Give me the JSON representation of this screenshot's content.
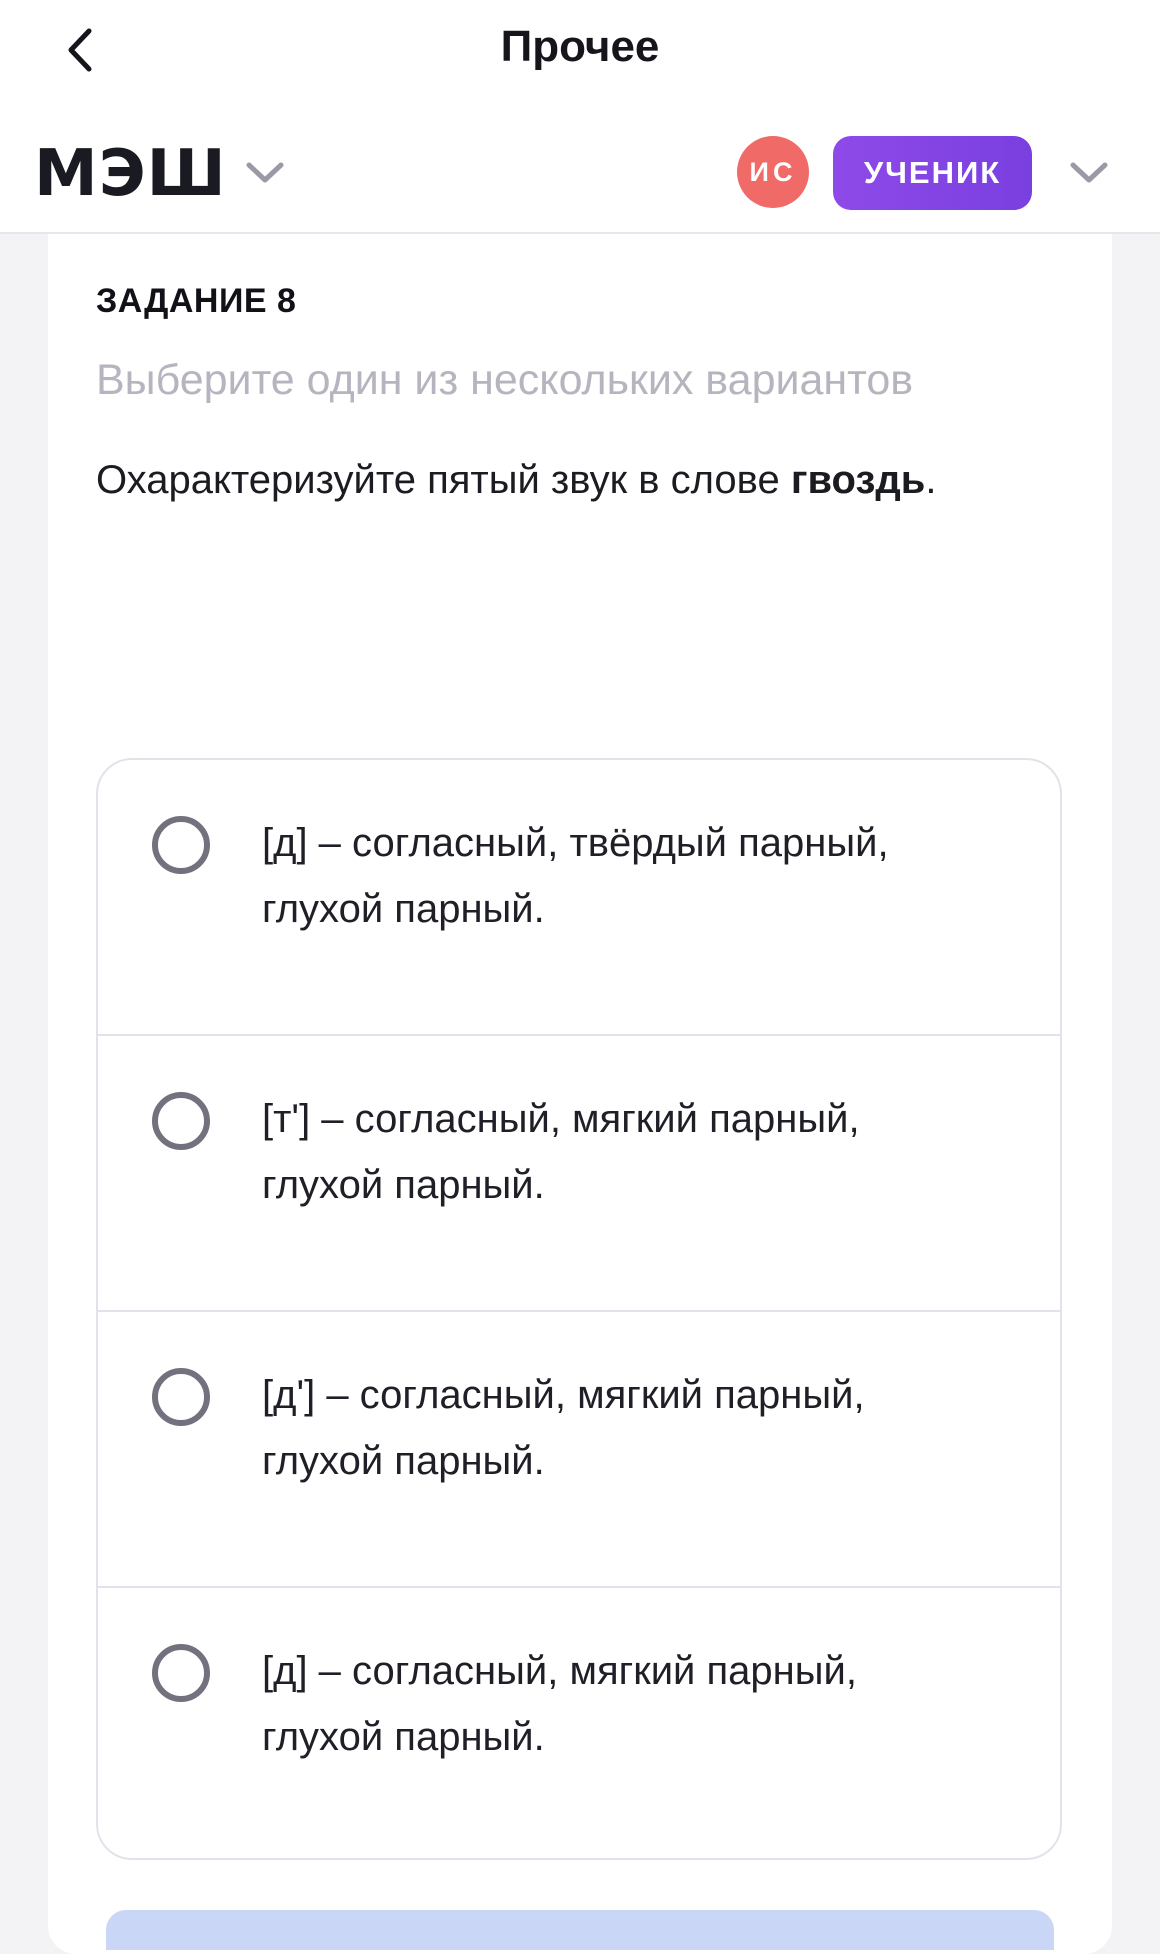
{
  "header": {
    "title": "Прочее",
    "logo": "МЭШ",
    "avatar_initials": "ИС",
    "role_label": "УЧЕНИК"
  },
  "task": {
    "label": "ЗАДАНИЕ 8",
    "hint": "Выберите один из нескольких вариантов",
    "question_prefix": "Охарактеризуйте пятый звук в слове ",
    "question_word": "гвоздь",
    "question_suffix": "."
  },
  "options": [
    {
      "line1": "[д] – согласный, твёрдый парный,",
      "line2": "глухой парный."
    },
    {
      "line1": "[т'] – согласный, мягкий парный,",
      "line2": "глухой парный."
    },
    {
      "line1": "[д'] – согласный, мягкий парный,",
      "line2": "глухой парный."
    },
    {
      "line1": "[д] – согласный, мягкий парный,",
      "line2": "глухой парный."
    }
  ],
  "colors": {
    "accent": "#7a3fe0",
    "avatar": "#f06a67",
    "hint": "#b5b5c0"
  },
  "icons": {
    "back": "chevron-left-icon",
    "dropdown": "chevron-down-icon",
    "radio": "radio-unchecked-icon"
  }
}
